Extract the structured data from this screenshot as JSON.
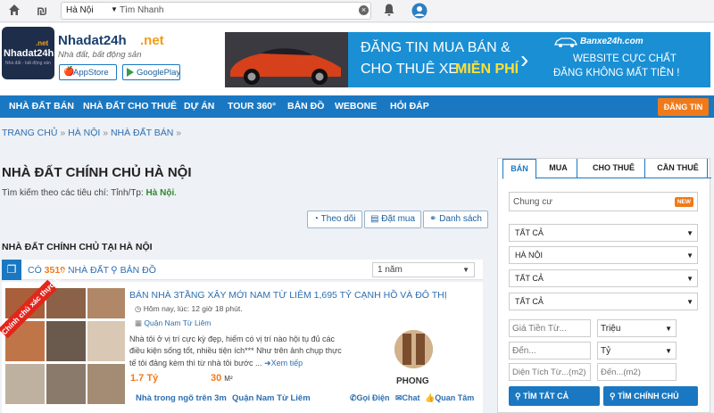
{
  "topbar": {
    "location": "Hà Nội",
    "search_placeholder": "Tìm Nhanh"
  },
  "brand": {
    "logo_top": ".net",
    "logo_main": "Nhadat24h",
    "logo_sub": "Nhà đất - bất động sản",
    "name": "Nhadat24h",
    "name_suffix": ".net",
    "tagline": "Nhà đất, bất động sản",
    "appstore": "AppStore",
    "googleplay": "GooglePlay"
  },
  "banner": {
    "line1": "ĐĂNG TIN MUA BÁN &",
    "line2a": "CHO THUÊ XE ",
    "line2b": "MIỄN PHÍ",
    "site": "Banxe24h.com",
    "right1": "WEBSITE CỰC CHẤT",
    "right2": "ĐĂNG KHÔNG MẤT TIỀN !"
  },
  "nav": {
    "items": [
      "NHÀ ĐẤT BÁN",
      "NHÀ ĐẤT CHO THUÊ",
      "DỰ ÁN",
      "TOUR 360°",
      "BẢN ĐỒ",
      "WEBONE",
      "HỎI ĐÁP"
    ],
    "post": "ĐĂNG TIN"
  },
  "breadcrumb": [
    "TRANG CHỦ",
    "HÀ NỘI",
    "NHÀ ĐẤT BÁN"
  ],
  "breadcrumb_sep": "»",
  "page": {
    "title": "NHÀ ĐẤT CHÍNH CHỦ HÀ NỘI",
    "criteria_prefix": "Tìm kiếm theo các tiêu chí: Tỉnh/Tp: ",
    "criteria_city": "Hà Nội",
    "criteria_end": ".",
    "follow": "Theo dõi",
    "buy": "Đặt mua",
    "list": "Danh sách",
    "section": "NHÀ ĐẤT CHÍNH CHỦ TẠI HÀ NỘI"
  },
  "results": {
    "prefix": "CÓ ",
    "count": "3519",
    "suffix": " NHÀ ĐẤT",
    "map": "BẢN ĐỒ",
    "period": "1 năm"
  },
  "listing": {
    "ribbon": "Chính chủ xác thực 100%",
    "title": "BÁN NHÀ 3TẦNG XÂY MỚI NAM TỪ LIÊM 1,695 TỶ CẠNH HỒ VÀ ĐÔ THỊ",
    "time": "Hôm nay, lúc: 12 giờ 18 phút.",
    "district": "Quận Nam Từ Liêm",
    "desc": "Nhà tôi ở vị trí cực kỳ đẹp, hiếm có vị trí nào hội tụ đủ các điều kiện sống tốt, nhiều tiện ích*** Như trên ảnh chụp thực tế tôi đảng kèm thì từ nhà tôi bước ...",
    "more": "Xem tiếp",
    "price": "1.7 Tỷ",
    "area": "30 ",
    "area_unit": "M²",
    "alley": "Nhà trong ngõ trên 3m",
    "loc": "Quận Nam Từ Liêm",
    "agent": "PHONG",
    "call": "Gọi Điện",
    "chat": "Chat",
    "care": "Quan Tâm"
  },
  "filter": {
    "tabs": [
      "BÁN",
      "MUA",
      "CHO THUÊ",
      "CẦN THUÊ"
    ],
    "type": "Chung cư",
    "new_badge": "NEW",
    "selects": [
      "TẤT CẢ",
      "HÀ NỘI",
      "TẤT CẢ",
      "TẤT CẢ"
    ],
    "price_from": "Giá Tiền Từ...",
    "unit1": "Triệu",
    "price_to": "Đến...",
    "unit2": "Tỷ",
    "area_from": "Diện Tích Từ...(m2)",
    "area_to": "Đến...(m2)",
    "search_all": "TÌM TẤT CẢ",
    "search_owner": "TÌM CHÍNH CHỦ"
  },
  "colors": {
    "nav": "#1a78c2",
    "accent_orange": "#f07a1a",
    "banner": "#1a8fd4"
  }
}
